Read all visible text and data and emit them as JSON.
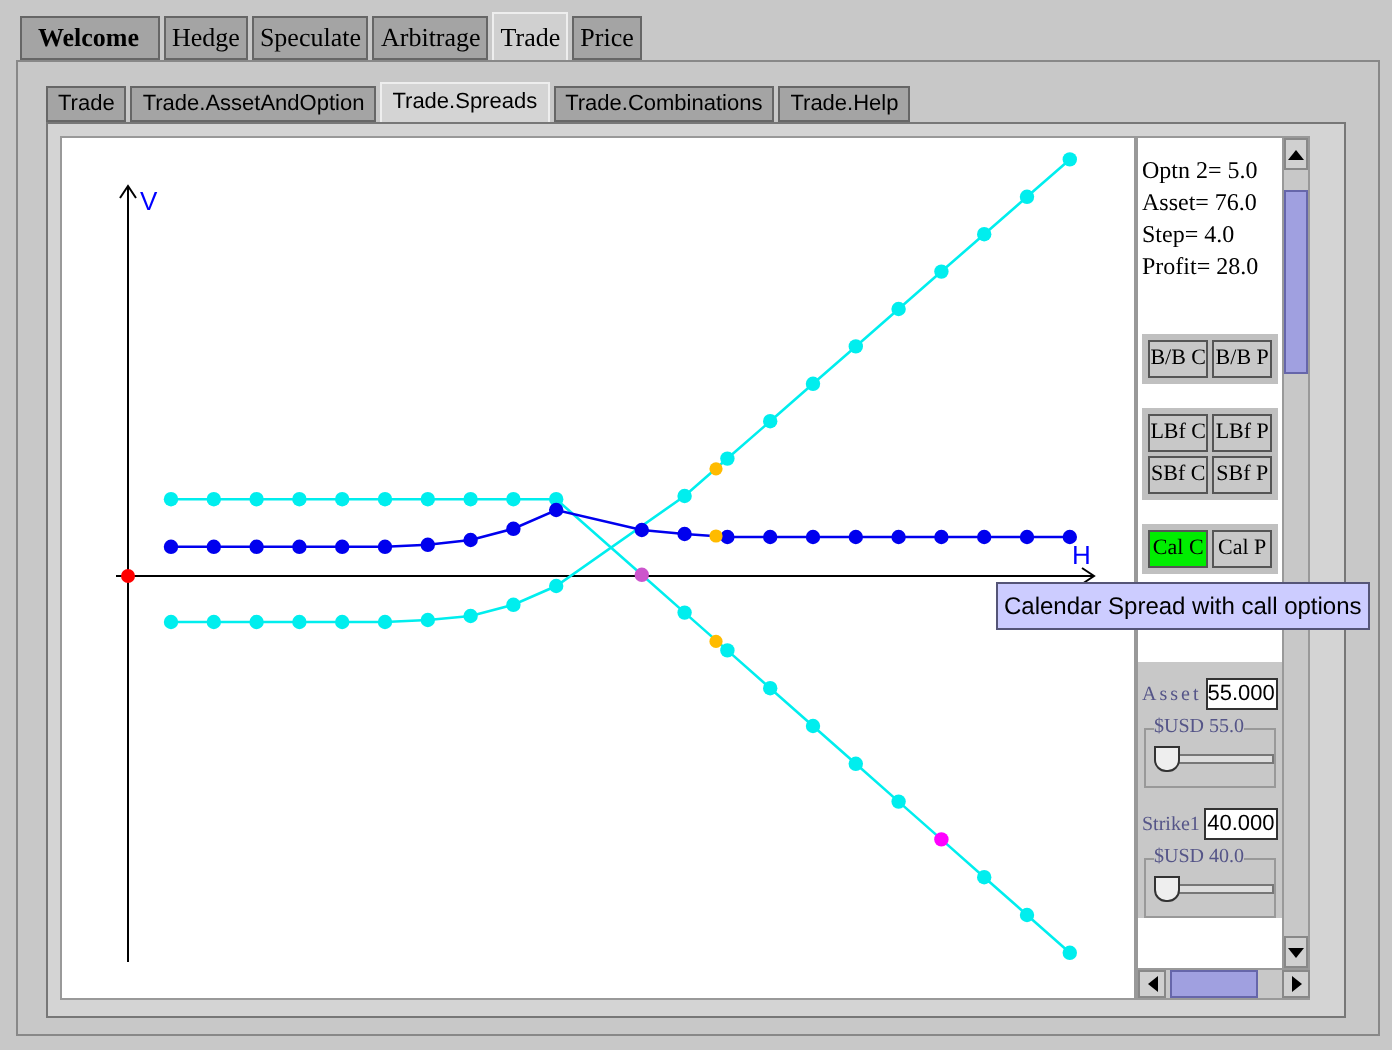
{
  "main_tabs": [
    {
      "label": "Welcome",
      "selected": false
    },
    {
      "label": "Hedge",
      "selected": false
    },
    {
      "label": "Speculate",
      "selected": false
    },
    {
      "label": "Arbitrage",
      "selected": false
    },
    {
      "label": "Trade",
      "selected": true
    },
    {
      "label": "Price",
      "selected": false
    }
  ],
  "sub_tabs": [
    {
      "label": "Trade",
      "selected": false
    },
    {
      "label": "Trade.AssetAndOption",
      "selected": false
    },
    {
      "label": "Trade.Spreads",
      "selected": true
    },
    {
      "label": "Trade.Combinations",
      "selected": false
    },
    {
      "label": "Trade.Help",
      "selected": false
    }
  ],
  "chart": {
    "y_axis_label": "V",
    "x_axis_label": "H"
  },
  "readouts": [
    "Optn 2= 5.0",
    "Asset= 76.0",
    "Step= 4.0",
    "Profit= 28.0"
  ],
  "button_groups": [
    [
      {
        "label": "B/B C",
        "selected": false
      },
      {
        "label": "B/B P",
        "selected": false
      }
    ],
    [
      {
        "label": "LBf C",
        "selected": false
      },
      {
        "label": "LBf P",
        "selected": false
      },
      {
        "label": "SBf C",
        "selected": false
      },
      {
        "label": "SBf P",
        "selected": false
      }
    ],
    [
      {
        "label": "Cal C",
        "selected": true
      },
      {
        "label": "Cal P",
        "selected": false
      }
    ]
  ],
  "inputs": [
    {
      "label": "Asset",
      "value": "55.000",
      "group_label": "$USD 55.0",
      "level": 0
    },
    {
      "label": "Strike1",
      "value": "40.000",
      "group_label": "$USD 40.0",
      "level": 0
    }
  ],
  "tooltip": "Calendar Spread with call options"
}
